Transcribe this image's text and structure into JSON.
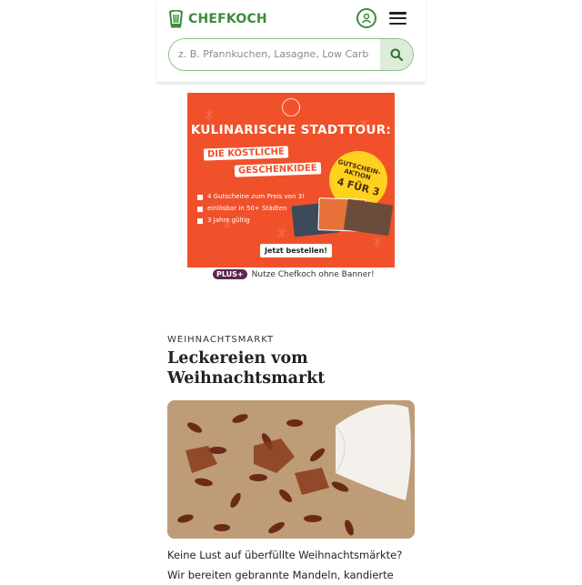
{
  "header": {
    "brand": "CHEFKOCH",
    "search": {
      "placeholder": "z. B. Pfannkuchen, Lasagne, Low Carb",
      "value": ""
    }
  },
  "ad": {
    "title": "KULINARISCHE STADTTOUR:",
    "subtitle_1": "DIE KÖSTLICHE",
    "subtitle_2": "GESCHENKIDEE",
    "promo_small": "GUTSCHEIN-\nAKTION",
    "promo_big": "4 FÜR 3",
    "bullets": [
      "4 Gutscheine zum Preis von 3!",
      "einlösbar in 50+ Städten",
      "3 Jahre gültig"
    ],
    "cta": "Jetzt bestellen!",
    "colors": {
      "background": "#f0512a",
      "promo": "#ffd21f"
    }
  },
  "plus": {
    "badge": "PLUS+",
    "text": "Nutze Chefkoch ohne Banner!"
  },
  "article": {
    "kicker": "WEIHNACHTSMARKT",
    "title": "Leckereien vom Weihnachtsmarkt",
    "teaser": "Keine Lust auf überfüllte Weihnachtsmärkte? Wir bereiten gebrannte Mandeln, kandierte"
  },
  "colors": {
    "brand_green": "#3d8b3a",
    "plus_purple": "#5e2750"
  }
}
